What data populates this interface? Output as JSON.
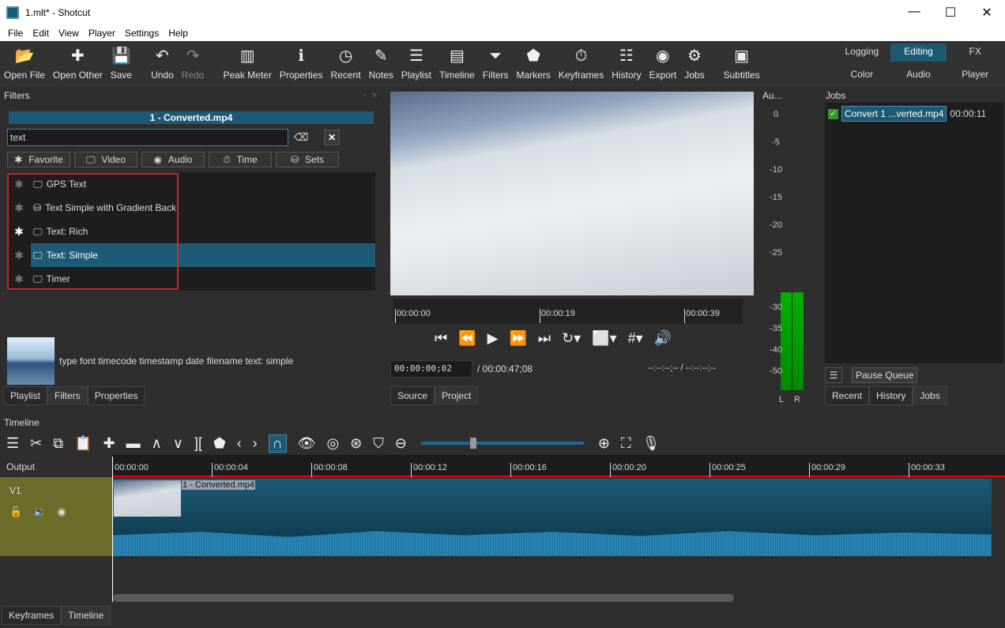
{
  "window": {
    "title": "1.mlt* - Shotcut",
    "controls": [
      "—",
      "☐",
      "✕"
    ]
  },
  "menu": [
    "File",
    "Edit",
    "View",
    "Player",
    "Settings",
    "Help"
  ],
  "toolbar": [
    {
      "label": "Open File",
      "icon": "folder-open-icon",
      "glyph": "📂"
    },
    {
      "label": "Open Other",
      "icon": "open-other-icon",
      "glyph": "✚"
    },
    {
      "label": "Save",
      "icon": "save-icon",
      "glyph": "💾"
    },
    {
      "label": "Undo",
      "icon": "undo-icon",
      "glyph": "↶"
    },
    {
      "label": "Redo",
      "icon": "redo-icon",
      "glyph": "↷",
      "disabled": true
    },
    {
      "label": "Peak Meter",
      "icon": "peak-meter-icon",
      "glyph": "▥"
    },
    {
      "label": "Properties",
      "icon": "info-icon",
      "glyph": "ℹ"
    },
    {
      "label": "Recent",
      "icon": "clock-icon",
      "glyph": "◷"
    },
    {
      "label": "Notes",
      "icon": "notes-icon",
      "glyph": "✎"
    },
    {
      "label": "Playlist",
      "icon": "list-icon",
      "glyph": "☰"
    },
    {
      "label": "Timeline",
      "icon": "timeline-icon",
      "glyph": "▤"
    },
    {
      "label": "Filters",
      "icon": "filter-icon",
      "glyph": "⏷"
    },
    {
      "label": "Markers",
      "icon": "marker-icon",
      "glyph": "⬟"
    },
    {
      "label": "Keyframes",
      "icon": "stopwatch-icon",
      "glyph": "⏱"
    },
    {
      "label": "History",
      "icon": "history-icon",
      "glyph": "☷"
    },
    {
      "label": "Export",
      "icon": "export-icon",
      "glyph": "◉"
    },
    {
      "label": "Jobs",
      "icon": "gear-icon",
      "glyph": "⚙"
    },
    {
      "label": "Subtitles",
      "icon": "subtitles-icon",
      "glyph": "▣"
    }
  ],
  "layouts": [
    {
      "label": "Logging"
    },
    {
      "label": "Editing",
      "active": true
    },
    {
      "label": "FX"
    },
    {
      "label": "Color"
    },
    {
      "label": "Audio"
    },
    {
      "label": "Player"
    }
  ],
  "filters": {
    "title": "Filters",
    "clip": "1 - Converted.mp4",
    "search": "text",
    "categories": [
      "Favorite",
      "Video",
      "Audio",
      "Time",
      "Sets"
    ],
    "items": [
      {
        "name": "GPS Text",
        "icon": "monitor-icon",
        "favorite": false
      },
      {
        "name": "Text Simple with Gradient Back",
        "icon": "sets-icon",
        "favorite": false
      },
      {
        "name": "Text: Rich",
        "icon": "monitor-icon",
        "favorite": true
      },
      {
        "name": "Text: Simple",
        "icon": "monitor-icon",
        "favorite": false,
        "selected": true
      },
      {
        "name": "Timer",
        "icon": "monitor-icon",
        "favorite": false
      }
    ],
    "description": "type font timecode timestamp date filename text: simple",
    "tabs": [
      "Playlist",
      "Filters",
      "Properties"
    ],
    "highlight_color": "#e02020"
  },
  "player": {
    "ticks": [
      "00:00:00",
      "00:00:19",
      "00:00:39"
    ],
    "timecode": "00:00:00;02",
    "duration": "/ 00:00:47;08",
    "inout": "--:--:--;-- / --:--:--;--",
    "tabs": [
      "Source",
      "Project"
    ]
  },
  "meter": {
    "title": "Au...",
    "scale": [
      "0",
      "-5",
      "-10",
      "-15",
      "-20",
      "-25",
      "-30",
      "-35",
      "-40",
      "-50"
    ],
    "channels": [
      "L",
      "R"
    ]
  },
  "jobs": {
    "title": "Jobs",
    "job_name": "Convert 1 ...verted.mp4",
    "job_time": "00:00:11",
    "pause": "Pause Queue",
    "tabs": [
      "Recent",
      "History",
      "Jobs"
    ]
  },
  "timeline": {
    "title": "Timeline",
    "output": "Output",
    "track": "V1",
    "clip": "1 - Converted.mp4",
    "ticks": [
      "00:00:00",
      "00:00:04",
      "00:00:08",
      "00:00:12",
      "00:00:16",
      "00:00:20",
      "00:00:25",
      "00:00:29",
      "00:00:33"
    ]
  },
  "bottom_tabs": [
    "Keyframes",
    "Timeline"
  ],
  "colors": {
    "accent": "#1d5a76",
    "track": "#6b6b2a",
    "playhead": "#e00000"
  }
}
